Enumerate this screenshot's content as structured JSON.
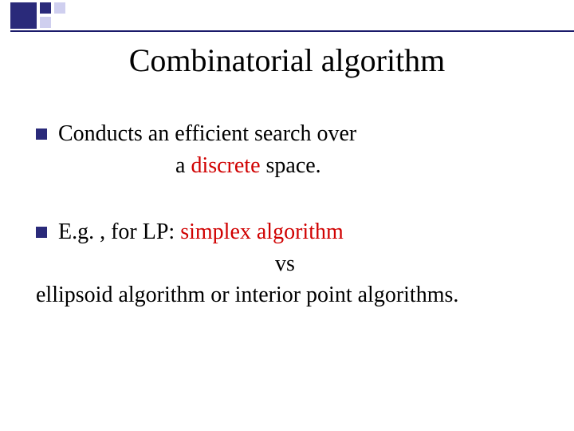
{
  "title": "Combinatorial algorithm",
  "bullet1": {
    "line1": "Conducts an efficient search over",
    "line2_prefix": "a ",
    "line2_red": "discrete",
    "line2_suffix": " space."
  },
  "bullet2": {
    "line1_prefix": "E.g. , for LP:    ",
    "line1_red": "simplex algorithm",
    "vs": "vs",
    "line3": "ellipsoid algorithm or interior point algorithms."
  }
}
